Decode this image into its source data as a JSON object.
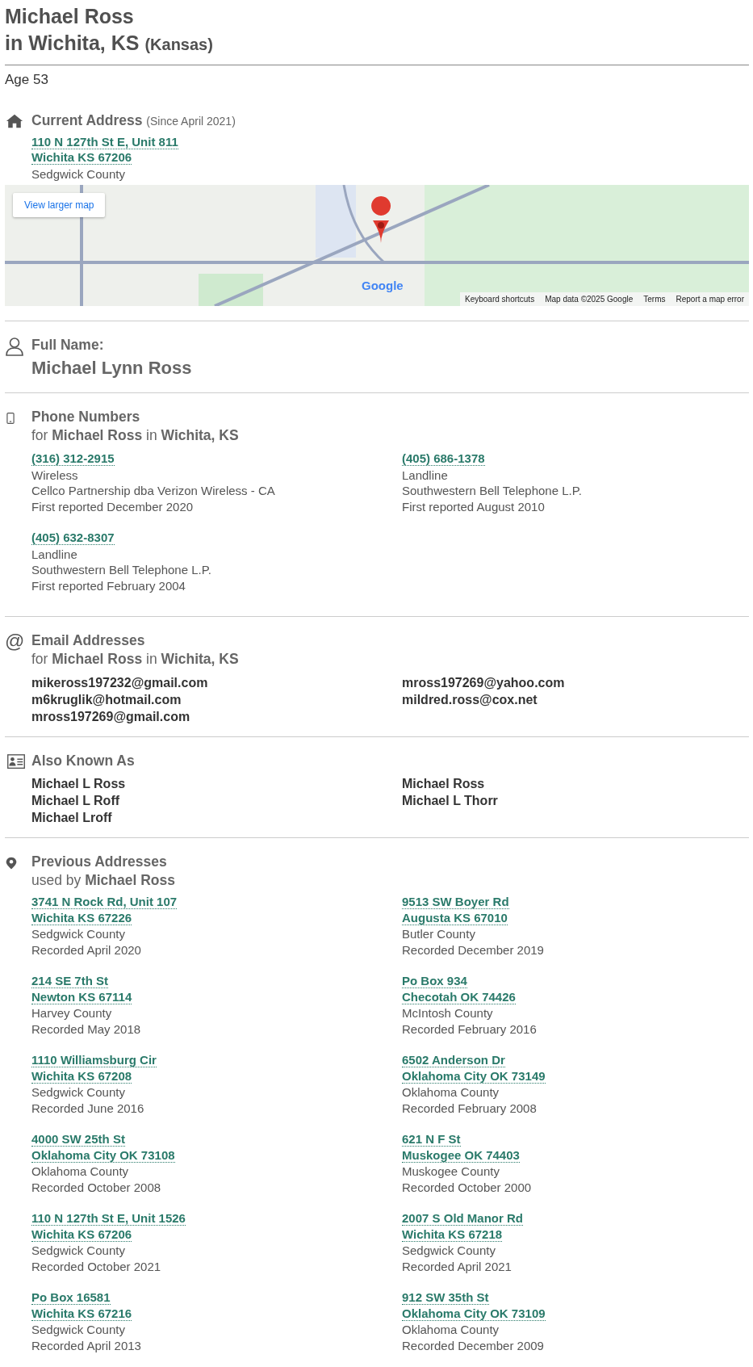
{
  "header": {
    "name": "Michael Ross",
    "location": "in Wichita, KS",
    "state": "(Kansas)"
  },
  "age": "Age 53",
  "current_address": {
    "title": "Current Address",
    "since": "(Since April 2021)",
    "lines": [
      "110 N 127th St E, Unit 811",
      "Wichita KS 67206"
    ],
    "county": "Sedgwick County",
    "map": {
      "button": "View larger map",
      "logo": "Google",
      "footer": [
        "Keyboard shortcuts",
        "Map data ©2025 Google",
        "Terms",
        "Report a map error"
      ]
    }
  },
  "full_name": {
    "label": "Full Name:",
    "value": "Michael Lynn Ross"
  },
  "phones": {
    "title": "Phone Numbers",
    "subtitle": "for **Michael Ross** in **Wichita, KS**",
    "items": [
      {
        "number": "(316) 312-2915",
        "type": "Wireless",
        "carrier": "Cellco Partnership dba Verizon Wireless - CA",
        "reported": "First reported December 2020"
      },
      {
        "number": "(405) 686-1378",
        "type": "Landline",
        "carrier": "Southwestern Bell Telephone L.P.",
        "reported": "First reported August 2010"
      },
      {
        "number": "(405) 632-8307",
        "type": "Landline",
        "carrier": "Southwestern Bell Telephone L.P.",
        "reported": "First reported February 2004"
      }
    ]
  },
  "emails": {
    "icon": "@",
    "title": "Email Addresses",
    "subtitle": "for **Michael Ross** in **Wichita, KS**",
    "columns": [
      [
        "mikeross197232@gmail.com",
        "m6kruglik@hotmail.com",
        "mross197269@gmail.com"
      ],
      [
        "mross197269@yahoo.com",
        "mildred.ross@cox.net"
      ]
    ]
  },
  "aka": {
    "title": "Also Known As",
    "columns": [
      [
        "Michael L Ross",
        "Michael L Roff",
        "Michael Lroff"
      ],
      [
        "Michael Ross",
        "Michael L Thorr"
      ]
    ]
  },
  "previous_addresses": {
    "title": "Previous Addresses",
    "subtitle": "used by **Michael Ross**",
    "items": [
      {
        "lines": [
          "3741 N Rock Rd, Unit 107",
          "Wichita KS 67226"
        ],
        "county": "Sedgwick County",
        "recorded": "Recorded April 2020"
      },
      {
        "lines": [
          "9513 SW Boyer Rd",
          "Augusta KS 67010"
        ],
        "county": "Butler County",
        "recorded": "Recorded December 2019"
      },
      {
        "lines": [
          "214 SE 7th St",
          "Newton KS 67114"
        ],
        "county": "Harvey County",
        "recorded": "Recorded May 2018"
      },
      {
        "lines": [
          "Po Box 934",
          "Checotah OK 74426"
        ],
        "county": "McIntosh County",
        "recorded": "Recorded February 2016"
      },
      {
        "lines": [
          "1110 Williamsburg Cir",
          "Wichita KS 67208"
        ],
        "county": "Sedgwick County",
        "recorded": "Recorded June 2016"
      },
      {
        "lines": [
          "6502 Anderson Dr",
          "Oklahoma City OK 73149"
        ],
        "county": "Oklahoma County",
        "recorded": "Recorded February 2008"
      },
      {
        "lines": [
          "4000 SW 25th St",
          "Oklahoma City OK 73108"
        ],
        "county": "Oklahoma County",
        "recorded": "Recorded October 2008"
      },
      {
        "lines": [
          "621 N F St",
          "Muskogee OK 74403"
        ],
        "county": "Muskogee County",
        "recorded": "Recorded October 2000"
      },
      {
        "lines": [
          "110 N 127th St E, Unit 1526",
          "Wichita KS 67206"
        ],
        "county": "Sedgwick County",
        "recorded": "Recorded October 2021"
      },
      {
        "lines": [
          "2007 S Old Manor Rd",
          "Wichita KS 67218"
        ],
        "county": "Sedgwick County",
        "recorded": "Recorded April 2021"
      },
      {
        "lines": [
          "Po Box 16581",
          "Wichita KS 67216"
        ],
        "county": "Sedgwick County",
        "recorded": "Recorded April 2013"
      },
      {
        "lines": [
          "912 SW 35th St",
          "Oklahoma City OK 73109"
        ],
        "county": "Oklahoma County",
        "recorded": "Recorded December 2009"
      }
    ]
  }
}
